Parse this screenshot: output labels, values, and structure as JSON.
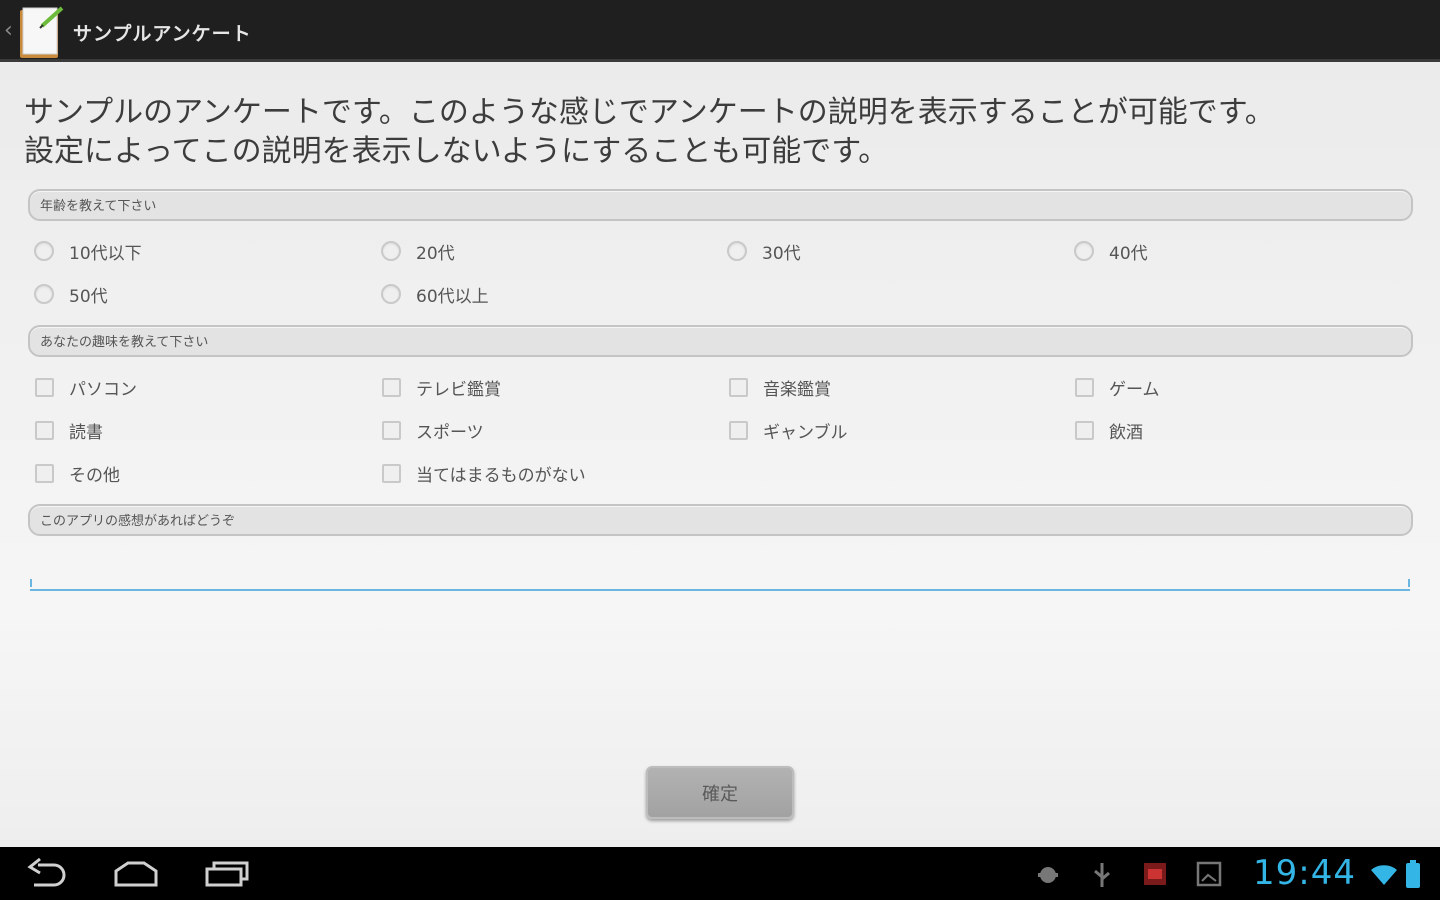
{
  "action_bar": {
    "title": "サンプルアンケート",
    "up_caret": "‹"
  },
  "description": {
    "line1": "サンプルのアンケートです。このような感じでアンケートの説明を表示することが可能です。",
    "line2": "設定によってこの説明を表示しないようにすることも可能です。"
  },
  "questions": {
    "age": {
      "header": "年齢を教えて下さい",
      "options": [
        "10代以下",
        "20代",
        "30代",
        "40代",
        "50代",
        "60代以上"
      ]
    },
    "hobby": {
      "header": "あなたの趣味を教えて下さい",
      "options": [
        "パソコン",
        "テレビ鑑賞",
        "音楽鑑賞",
        "ゲーム",
        "読書",
        "スポーツ",
        "ギャンブル",
        "飲酒",
        "その他",
        "当てはまるものがない"
      ]
    },
    "comment": {
      "header": "このアプリの感想があればどうぞ",
      "value": "",
      "placeholder": ""
    }
  },
  "confirm_button": {
    "label": "確定"
  },
  "system_bar": {
    "clock": "19:44",
    "accent_color": "#33b5e5",
    "icons": [
      "back-icon",
      "home-icon",
      "recent-apps-icon",
      "android-debug-icon",
      "usb-icon",
      "notification-app-icon",
      "screenshot-icon",
      "wifi-icon",
      "battery-icon"
    ]
  }
}
